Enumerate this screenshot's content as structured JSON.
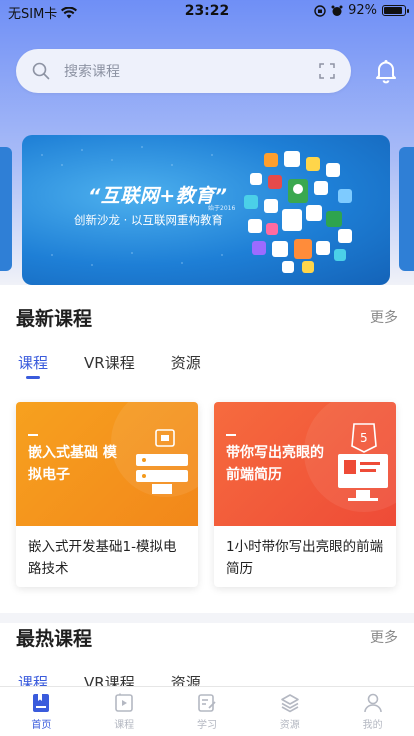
{
  "status_bar": {
    "carrier": "无SIM卡",
    "time": "23:22",
    "battery": "92%",
    "battery_level": 0.92
  },
  "search": {
    "placeholder": "搜索课程"
  },
  "banner": {
    "title": "“互联网+教育”",
    "since": "始于2016",
    "subtitle": "创新沙龙 · 以互联网重构教育"
  },
  "latest": {
    "title": "最新课程",
    "more": "更多",
    "tabs": [
      "课程",
      "VR课程",
      "资源"
    ],
    "courses": [
      {
        "thumb_title": "嵌入式基础 模拟电子",
        "name": "嵌入式开发基础1-模拟电路技术"
      },
      {
        "thumb_title": "带你写出亮眼的 前端简历",
        "name": "1小时带你写出亮眼的前端简历"
      }
    ]
  },
  "hot": {
    "title": "最热课程",
    "more": "更多",
    "tabs": [
      "课程",
      "VR课程",
      "资源"
    ]
  },
  "bottom_nav": [
    {
      "label": "首页",
      "icon": "home-book-icon"
    },
    {
      "label": "课程",
      "icon": "course-play-icon"
    },
    {
      "label": "学习",
      "icon": "study-edit-icon"
    },
    {
      "label": "资源",
      "icon": "resource-layers-icon"
    },
    {
      "label": "我的",
      "icon": "profile-icon"
    }
  ],
  "colors": {
    "accent": "#3a5bdc",
    "orange_card": "#f39a1c",
    "red_card": "#f0593b"
  }
}
